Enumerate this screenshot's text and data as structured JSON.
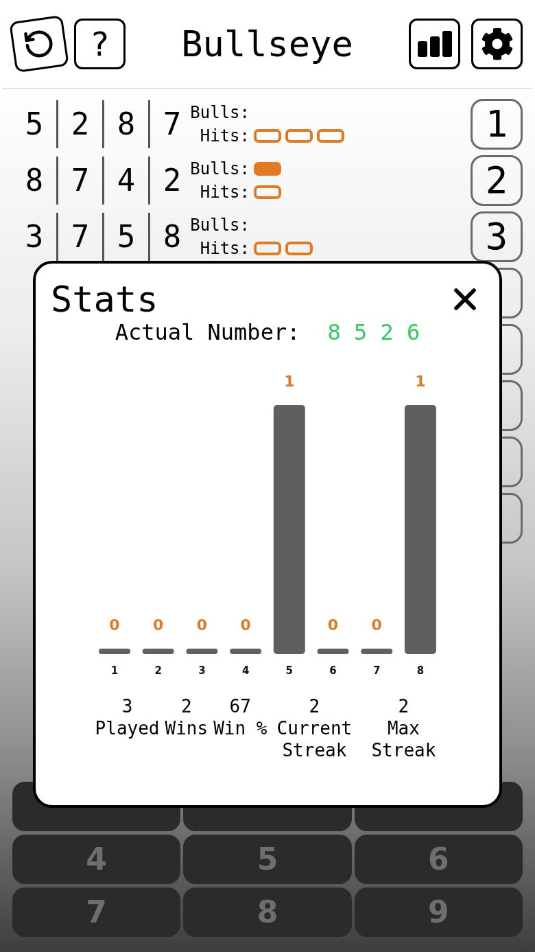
{
  "header": {
    "title": "Bullseye",
    "help_label": "?"
  },
  "rows": [
    {
      "digits": [
        "5",
        "2",
        "8",
        "7"
      ],
      "bulls_label": "Bulls:",
      "hits_label": "Hits:",
      "bull_pegs": [],
      "hit_pegs": [
        {
          "kind": "hit"
        },
        {
          "kind": "hit"
        },
        {
          "kind": "hit"
        }
      ],
      "number": "1"
    },
    {
      "digits": [
        "8",
        "7",
        "4",
        "2"
      ],
      "bulls_label": "Bulls:",
      "hits_label": "Hits:",
      "bull_pegs": [
        {
          "kind": "bull"
        }
      ],
      "hit_pegs": [
        {
          "kind": "hit"
        }
      ],
      "number": "2"
    },
    {
      "digits": [
        "3",
        "7",
        "5",
        "8"
      ],
      "bulls_label": "Bulls:",
      "hits_label": "Hits:",
      "bull_pegs": [],
      "hit_pegs": [
        {
          "kind": "hit"
        },
        {
          "kind": "hit"
        }
      ],
      "number": "3"
    },
    {
      "digits": []
    },
    {
      "digits": []
    },
    {
      "digits": []
    },
    {
      "digits": []
    },
    {
      "digits": []
    }
  ],
  "keypad": {
    "rows": [
      [
        {
          "kind": "key"
        },
        {
          "kind": "key"
        },
        {
          "kind": "key"
        }
      ],
      [
        {
          "kind": "key",
          "label": "4"
        },
        {
          "kind": "key",
          "label": "5"
        },
        {
          "kind": "key",
          "label": "6"
        }
      ],
      [
        {
          "kind": "key",
          "label": "7"
        },
        {
          "kind": "key",
          "label": "8"
        },
        {
          "kind": "key",
          "label": "9"
        }
      ]
    ]
  },
  "stats_dialog": {
    "title": "Stats",
    "actual_number_label": "Actual Number:",
    "actual_number": "8 5 2 6",
    "chart_data": {
      "type": "bar",
      "categories": [
        "1",
        "2",
        "3",
        "4",
        "5",
        "6",
        "7",
        "8"
      ],
      "values": [
        0,
        0,
        0,
        0,
        1,
        0,
        0,
        1
      ],
      "data_labels": true
    },
    "stats": [
      {
        "value": "3",
        "label": "Played"
      },
      {
        "value": "2",
        "label": "Wins"
      },
      {
        "value": "67",
        "label": "Win %"
      },
      {
        "value": "2",
        "label": "Current Streak"
      },
      {
        "value": "2",
        "label": "Max Streak"
      }
    ]
  }
}
